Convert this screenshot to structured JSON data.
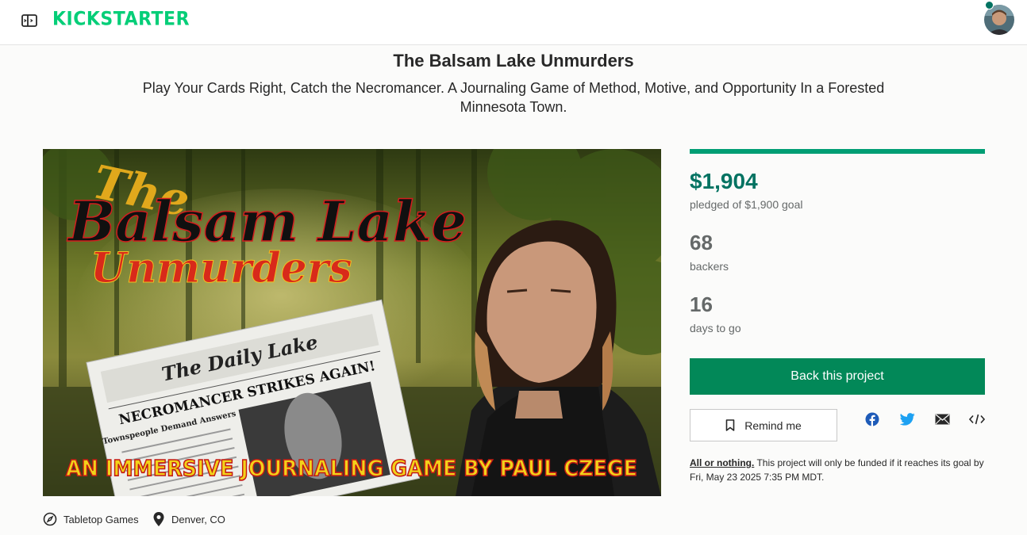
{
  "header": {
    "logo_text": "KICKSTARTER",
    "brand_color": "#05ce78"
  },
  "project": {
    "title": "The Balsam Lake Unmurders",
    "blurb": "Play Your Cards Right, Catch the Necromancer. A Journaling Game of Method, Motive, and Opportunity In a Forested Minnesota Town.",
    "category": "Tabletop Games",
    "location": "Denver, CO",
    "hero_image": {
      "title_line1": "The",
      "title_line2": "Balsam Lake",
      "title_line3": "Unmurders",
      "newspaper_masthead": "The Daily Lake",
      "newspaper_headline": "NECROMANCER STRIKES AGAIN!",
      "newspaper_sub": "Townspeople Demand Answers",
      "banner": "AN IMMERSIVE JOURNALING GAME BY PAUL CZEGE"
    }
  },
  "stats": {
    "progress_fraction": 1.0,
    "pledged": "$1,904",
    "pledged_sub": "pledged of $1,900 goal",
    "backers": "68",
    "backers_label": "backers",
    "days": "16",
    "days_label": "days to go"
  },
  "actions": {
    "back_label": "Back this project",
    "remind_label": "Remind me",
    "share_icons": [
      "facebook-icon",
      "twitter-icon",
      "email-icon",
      "embed-icon"
    ]
  },
  "note": {
    "aon_label": "All or nothing.",
    "text": " This project will only be funded if it reaches its goal by Fri, May 23 2025 7:35 PM MDT."
  },
  "colors": {
    "accent": "#037362",
    "button": "#028858",
    "progress": "#009e74"
  }
}
